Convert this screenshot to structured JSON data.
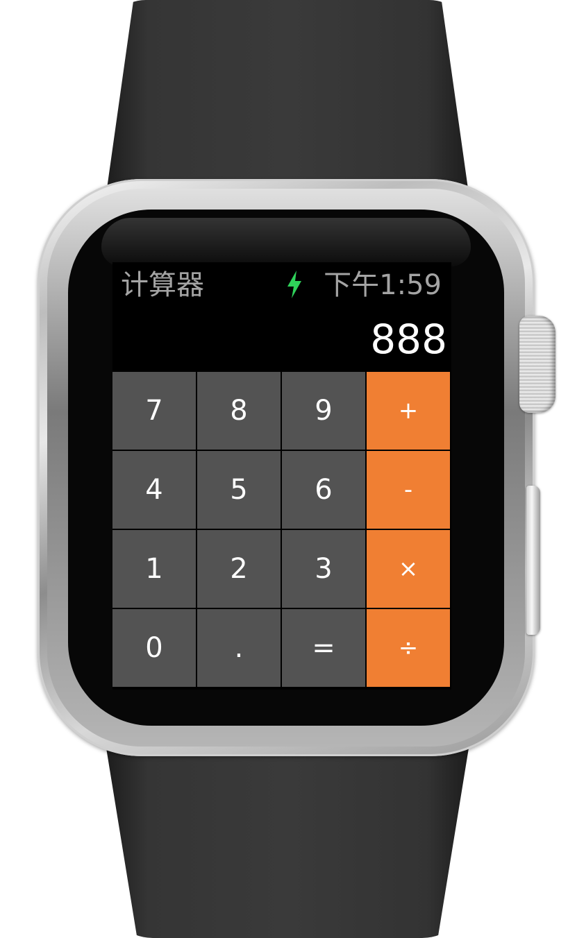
{
  "status_bar": {
    "app_title": "计算器",
    "charging_icon": "lightning-bolt-icon",
    "time": "下午1:59"
  },
  "display": {
    "value": "888"
  },
  "keypad": {
    "rows": [
      [
        {
          "label": "7",
          "kind": "digit"
        },
        {
          "label": "8",
          "kind": "digit"
        },
        {
          "label": "9",
          "kind": "digit"
        },
        {
          "label": "+",
          "kind": "operator"
        }
      ],
      [
        {
          "label": "4",
          "kind": "digit"
        },
        {
          "label": "5",
          "kind": "digit"
        },
        {
          "label": "6",
          "kind": "digit"
        },
        {
          "label": "-",
          "kind": "operator"
        }
      ],
      [
        {
          "label": "1",
          "kind": "digit"
        },
        {
          "label": "2",
          "kind": "digit"
        },
        {
          "label": "3",
          "kind": "digit"
        },
        {
          "label": "×",
          "kind": "operator"
        }
      ],
      [
        {
          "label": "0",
          "kind": "digit"
        },
        {
          "label": ".",
          "kind": "digit"
        },
        {
          "label": "=",
          "kind": "digit"
        },
        {
          "label": "÷",
          "kind": "operator"
        }
      ]
    ]
  },
  "colors": {
    "digit_key": "#535353",
    "operator_key": "#f07f33",
    "charging_bolt": "#2fd25a",
    "status_text": "#a4a4a4",
    "display_text": "#ffffff"
  }
}
